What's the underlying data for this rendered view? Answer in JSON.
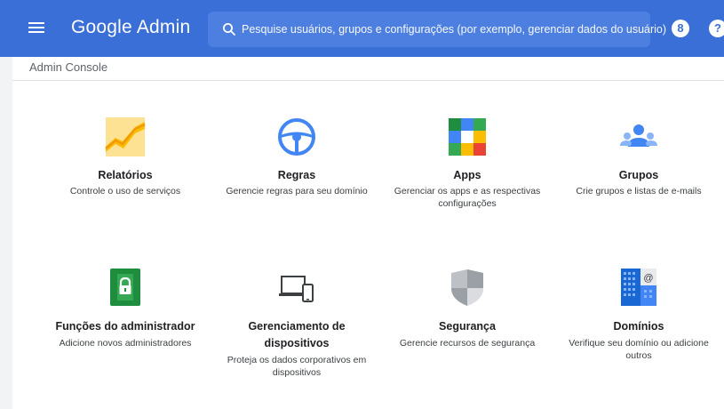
{
  "header": {
    "logo_google": "Google",
    "logo_admin": "Admin",
    "search_placeholder": "Pesquise usuários, grupos e configurações (por exemplo, gerenciar dados do usuário)",
    "support_icon_label": "8",
    "help_icon_label": "?"
  },
  "breadcrumb": {
    "label": "Admin Console"
  },
  "cards": [
    {
      "id": "reports",
      "icon": "reports-icon",
      "title": "Relatórios",
      "desc": "Controle o uso de serviços"
    },
    {
      "id": "rules",
      "icon": "steering-wheel-icon",
      "title": "Regras",
      "desc": "Gerencie regras para seu domínio"
    },
    {
      "id": "apps",
      "icon": "apps-grid-icon",
      "title": "Apps",
      "desc": "Gerenciar os apps e as respectivas configurações"
    },
    {
      "id": "groups",
      "icon": "groups-icon",
      "title": "Grupos",
      "desc": "Crie grupos e listas de e-mails"
    },
    {
      "id": "admin-roles",
      "icon": "lock-icon",
      "title": "Funções do administrador",
      "desc": "Adicione novos administradores"
    },
    {
      "id": "devices",
      "icon": "devices-icon",
      "title": "Gerenciamento de dispositivos",
      "desc": "Proteja os dados corporativos em dispositivos"
    },
    {
      "id": "security",
      "icon": "shield-icon",
      "title": "Segurança",
      "desc": "Gerencie recursos de segurança"
    },
    {
      "id": "domains",
      "icon": "domains-icon",
      "title": "Domínios",
      "desc": "Verifique seu domínio ou adicione outros"
    }
  ],
  "colors": {
    "topbar": "#3a6fd8",
    "search_bg": "#4d7fe0",
    "accent_green": "#34a853",
    "accent_blue": "#4285f4"
  }
}
